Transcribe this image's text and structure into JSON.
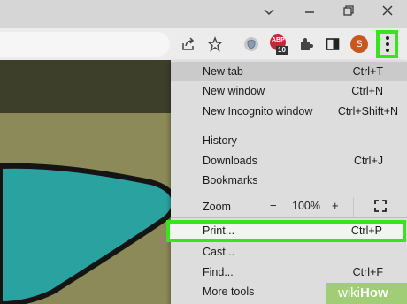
{
  "browser": {
    "extension_badge": "10",
    "extension_label": "ABP",
    "profile_initial": "S"
  },
  "menu": {
    "items_top": [
      {
        "label": "New tab",
        "shortcut": "Ctrl+T"
      },
      {
        "label": "New window",
        "shortcut": "Ctrl+N"
      },
      {
        "label": "New Incognito window",
        "shortcut": "Ctrl+Shift+N"
      }
    ],
    "history": {
      "label": "History",
      "shortcut": ""
    },
    "downloads": {
      "label": "Downloads",
      "shortcut": "Ctrl+J"
    },
    "bookmarks": {
      "label": "Bookmarks",
      "shortcut": ""
    },
    "zoom": {
      "label": "Zoom",
      "minus": "−",
      "value": "100%",
      "plus": "+"
    },
    "print": {
      "label": "Print...",
      "shortcut": "Ctrl+P"
    },
    "cast": {
      "label": "Cast...",
      "shortcut": ""
    },
    "find": {
      "label": "Find...",
      "shortcut": "Ctrl+F"
    },
    "more_tools": {
      "label": "More tools",
      "shortcut": ""
    }
  },
  "watermark": {
    "part1": "wiki",
    "part2": "How"
  },
  "colors": {
    "highlight": "#36e51b",
    "avatar": "#c9571e",
    "abp": "#c6283b"
  }
}
